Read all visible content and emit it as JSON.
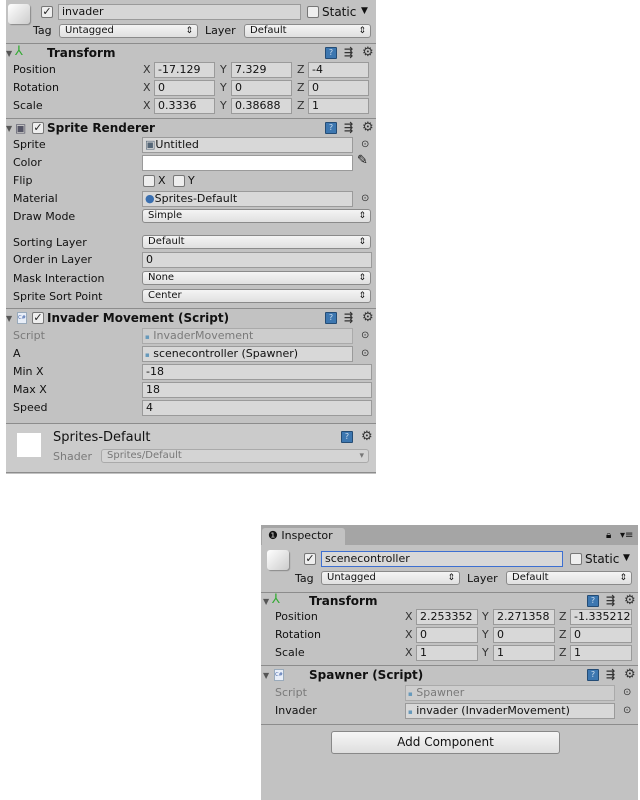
{
  "obj1": {
    "name": "invader",
    "active": true,
    "static_label": "Static",
    "tag_label": "Tag",
    "tag": "Untagged",
    "layer_label": "Layer",
    "layer": "Default",
    "transform": {
      "title": "Transform",
      "rows": [
        {
          "label": "Position",
          "x": "-17.129",
          "y": "7.329",
          "z": "-4"
        },
        {
          "label": "Rotation",
          "x": "0",
          "y": "0",
          "z": "0"
        },
        {
          "label": "Scale",
          "x": "0.3336",
          "y": "0.38688",
          "z": "1"
        }
      ]
    },
    "sprite_renderer": {
      "title": "Sprite Renderer",
      "sprite_label": "Sprite",
      "sprite": "Untitled",
      "color_label": "Color",
      "color": "#ffffff",
      "flip_label": "Flip",
      "flip_x": "X",
      "flip_y": "Y",
      "material_label": "Material",
      "material": "Sprites-Default",
      "draw_mode_label": "Draw Mode",
      "draw_mode": "Simple",
      "sorting_layer_label": "Sorting Layer",
      "sorting_layer": "Default",
      "order_label": "Order in Layer",
      "order": "0",
      "mask_label": "Mask Interaction",
      "mask": "None",
      "sort_point_label": "Sprite Sort Point",
      "sort_point": "Center"
    },
    "invader_movement": {
      "title": "Invader Movement (Script)",
      "script_label": "Script",
      "script": "InvaderMovement",
      "a_label": "A",
      "a": "scenecontroller (Spawner)",
      "minx_label": "Min X",
      "minx": "-18",
      "maxx_label": "Max X",
      "maxx": "18",
      "speed_label": "Speed",
      "speed": "4"
    },
    "material": {
      "name": "Sprites-Default",
      "shader_label": "Shader",
      "shader": "Sprites/Default"
    }
  },
  "inspector": {
    "tab": "Inspector",
    "obj": {
      "name": "scenecontroller",
      "active": true,
      "static_label": "Static",
      "tag_label": "Tag",
      "tag": "Untagged",
      "layer_label": "Layer",
      "layer": "Default"
    },
    "transform": {
      "title": "Transform",
      "rows": [
        {
          "label": "Position",
          "x": "2.253352",
          "y": "2.271358",
          "z": "-1.335212"
        },
        {
          "label": "Rotation",
          "x": "0",
          "y": "0",
          "z": "0"
        },
        {
          "label": "Scale",
          "x": "1",
          "y": "1",
          "z": "1"
        }
      ]
    },
    "spawner": {
      "title": "Spawner (Script)",
      "script_label": "Script",
      "script": "Spawner",
      "invader_label": "Invader",
      "invader": "invader (InvaderMovement)"
    },
    "add_component": "Add Component"
  },
  "axes": {
    "x": "X",
    "y": "Y",
    "z": "Z"
  }
}
